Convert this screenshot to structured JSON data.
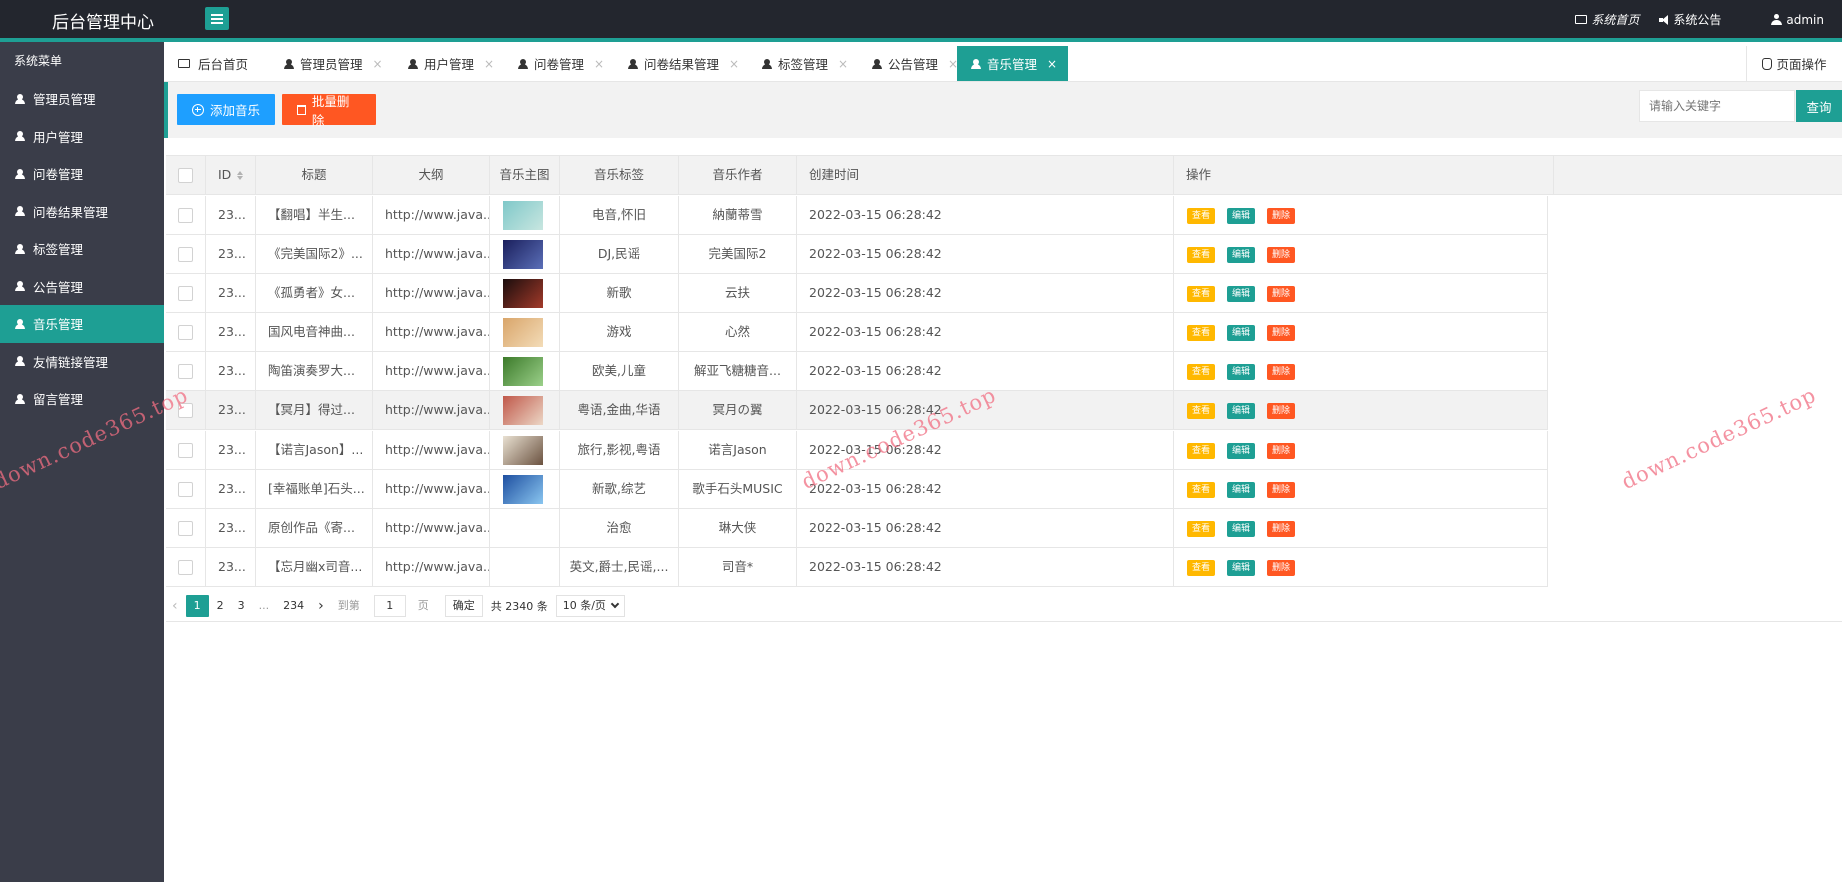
{
  "header": {
    "brand": "后台管理中心",
    "links": {
      "home": "系统首页",
      "notice": "系统公告",
      "user": "admin"
    }
  },
  "sidebar": {
    "title": "系统菜单",
    "items": [
      {
        "label": "管理员管理"
      },
      {
        "label": "用户管理"
      },
      {
        "label": "问卷管理"
      },
      {
        "label": "问卷结果管理"
      },
      {
        "label": "标签管理"
      },
      {
        "label": "公告管理"
      },
      {
        "label": "音乐管理"
      },
      {
        "label": "友情链接管理"
      },
      {
        "label": "留言管理"
      }
    ]
  },
  "tabs": {
    "home": "后台首页",
    "items": [
      {
        "label": "管理员管理"
      },
      {
        "label": "用户管理"
      },
      {
        "label": "问卷管理"
      },
      {
        "label": "问卷结果管理"
      },
      {
        "label": "标签管理"
      },
      {
        "label": "公告管理"
      },
      {
        "label": "音乐管理"
      }
    ],
    "close": "×",
    "page_ops": "页面操作"
  },
  "toolbar": {
    "add": "添加音乐",
    "batch_delete": "批量删除",
    "search_placeholder": "请输入关键字",
    "search": "查询"
  },
  "table": {
    "headers": {
      "id": "ID",
      "title": "标题",
      "outline": "大纲",
      "image": "音乐主图",
      "tags": "音乐标签",
      "author": "音乐作者",
      "created": "创建时间",
      "ops": "操作"
    },
    "ops": {
      "view": "查看",
      "edit": "编辑",
      "delete": "删除"
    },
    "rows": [
      {
        "id": "23...",
        "title": "【翻唱】半生...",
        "outline": "http://www.java...",
        "tags": "电音,怀旧",
        "author": "納蘭蒂雪",
        "created": "2022-03-15 06:28:42",
        "thumb": [
          "#7fc8c9",
          "#c8e6e0"
        ]
      },
      {
        "id": "23...",
        "title": "《完美国际2》...",
        "outline": "http://www.java...",
        "tags": "DJ,民谣",
        "author": "完美国际2",
        "created": "2022-03-15 06:28:42",
        "thumb": [
          "#1a1f5c",
          "#5b6fb8"
        ]
      },
      {
        "id": "23...",
        "title": "《孤勇者》女...",
        "outline": "http://www.java...",
        "tags": "新歌",
        "author": "云扶",
        "created": "2022-03-15 06:28:42",
        "thumb": [
          "#1a0d0d",
          "#a33a2a"
        ]
      },
      {
        "id": "23...",
        "title": "国风电音神曲...",
        "outline": "http://www.java...",
        "tags": "游戏",
        "author": "心然",
        "created": "2022-03-15 06:28:42",
        "thumb": [
          "#d9a56a",
          "#f3dcb8"
        ]
      },
      {
        "id": "23...",
        "title": "陶笛演奏罗大...",
        "outline": "http://www.java...",
        "tags": "欧美,儿童",
        "author": "解亚飞糖糖音...",
        "created": "2022-03-15 06:28:42",
        "thumb": [
          "#3c7a2a",
          "#9bd08a"
        ]
      },
      {
        "id": "23...",
        "title": "【冥月】得过...",
        "outline": "http://www.java...",
        "tags": "粤语,金曲,华语",
        "author": "冥月の翼",
        "created": "2022-03-15 06:28:42",
        "thumb": [
          "#c0584a",
          "#ecd7c6"
        ]
      },
      {
        "id": "23...",
        "title": "【诺言Jason】...",
        "outline": "http://www.java...",
        "tags": "旅行,影视,粤语",
        "author": "诺言Jason",
        "created": "2022-03-15 06:28:42",
        "thumb": [
          "#e9e1d2",
          "#6b5240"
        ]
      },
      {
        "id": "23...",
        "title": "[幸福账单]石头...",
        "outline": "http://www.java...",
        "tags": "新歌,综艺",
        "author": "歌手石头MUSIC",
        "created": "2022-03-15 06:28:42",
        "thumb": [
          "#1e4fa0",
          "#8ac6f0"
        ]
      },
      {
        "id": "23...",
        "title": "原创作品《寄...",
        "outline": "http://www.java...",
        "tags": "治愈",
        "author": "琳大侠",
        "created": "2022-03-15 06:28:42",
        "thumb": null
      },
      {
        "id": "23...",
        "title": "【忘月幽x司音...",
        "outline": "http://www.java...",
        "tags": "英文,爵士,民谣,...",
        "author": "司音*",
        "created": "2022-03-15 06:28:42",
        "thumb": null
      }
    ]
  },
  "pager": {
    "prev": "‹",
    "pages": [
      "1",
      "2",
      "3"
    ],
    "ellipsis": "...",
    "last": "234",
    "next": "›",
    "goto": "到第",
    "page_value": "1",
    "page_unit": "页",
    "confirm": "确定",
    "total": "共 2340 条",
    "size": "10 条/页"
  },
  "watermark": "down.code365.top",
  "colors": {
    "primary": "#1e9f94",
    "blue": "#1e9fff",
    "orange": "#ff5722",
    "yellow": "#ffb800",
    "header": "#23262e",
    "sidebar": "#3a3d49"
  }
}
